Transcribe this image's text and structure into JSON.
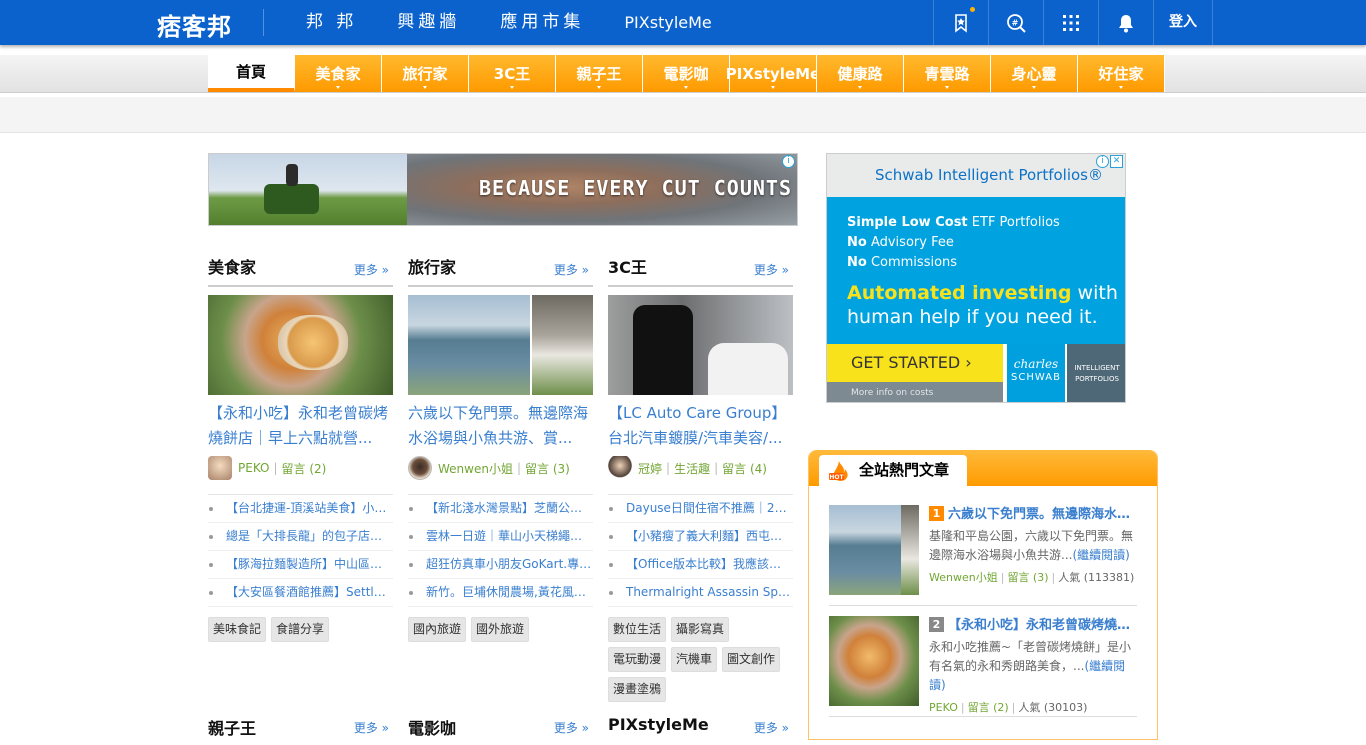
{
  "header": {
    "logo": "痞客邦",
    "nav": [
      "邦 邦",
      "興趣牆",
      "應用市集",
      "PIXstyleMe"
    ],
    "login": "登入"
  },
  "categories": [
    "首頁",
    "美食家",
    "旅行家",
    "3C王",
    "親子王",
    "電影咖",
    "PIXstyleMe",
    "健康路",
    "青雲路",
    "身心靈",
    "好住家"
  ],
  "banner_ad": {
    "text": "BECAUSE EVERY CUT COUNTS"
  },
  "columns": [
    {
      "title": "美食家",
      "more": "更多 »",
      "post_title": "【永和小吃】永和老曾碳烤燒餅店｜早上六點就營...",
      "author": "PEKO",
      "comments": "留言 (2)",
      "channel": "",
      "links": [
        "【台北捷運-頂溪站美食】小…",
        "總是「大排長龍」的包子店！…",
        "【豚海拉麵製造所】中山區拉…",
        "【大安區餐酒館推薦】Settle …"
      ],
      "tags": [
        "美味食記",
        "食譜分享"
      ]
    },
    {
      "title": "旅行家",
      "more": "更多 »",
      "post_title": "六歲以下免門票。無邊際海水浴場與小魚共游、賞...",
      "author": "Wenwen小姐",
      "comments": "留言 (3)",
      "channel": "",
      "links": [
        "【新北淺水灣景點】芝蘭公園…",
        "雲林一日遊｜華山小天梯繩索…",
        "超狂仿真車小朋友GoKart.專…",
        "新竹。巨埔休閒農場,黃花風…"
      ],
      "tags": [
        "國內旅遊",
        "國外旅遊"
      ]
    },
    {
      "title": "3C王",
      "more": "更多 »",
      "post_title": "【LC Auto Care Group】台北汽車鍍膜/汽車美容/...",
      "author": "冠婷",
      "comments": "留言 (4)",
      "channel": "生活趣",
      "links": [
        "Dayuse日間住宿不推薦｜20…",
        "【小豬瘦了義大利麵】西屯聚…",
        "【Office版本比較】我應該買…",
        "Thermalright Assassin Spirit …"
      ],
      "tags": [
        "數位生活",
        "攝影寫真",
        "電玩動漫",
        "汽機車",
        "圖文創作",
        "漫畫塗鴉"
      ]
    }
  ],
  "columns_row2": [
    {
      "title": "親子王",
      "more": "更多 »"
    },
    {
      "title": "電影咖",
      "more": "更多 »"
    },
    {
      "title": "PIXstyleMe",
      "more": "更多 »"
    }
  ],
  "side_ad": {
    "headline": "Schwab Intelligent Portfolios®",
    "lines": [
      {
        "b": "Simple Low Cost",
        "t": " ETF Portfolios"
      },
      {
        "b": "No",
        "t": " Advisory Fee"
      },
      {
        "b": "No",
        "t": " Commissions"
      }
    ],
    "big_highlight": "Automated investing",
    "big_rest": " with human help if you need it.",
    "cta": "GET STARTED  ›",
    "costs": "More info on costs",
    "brand_script": "charles",
    "brand": "SCHWAB",
    "product": "INTELLIGENT PORTFOLIOS"
  },
  "hot": {
    "title": "全站熱門文章",
    "items": [
      {
        "rank": "1",
        "title": "六歲以下免門票。無邊際海水浴場與小魚共游",
        "desc": "基隆和平島公園，六歲以下免門票。無邊際海水浴場與小魚共游...",
        "more": "(繼續閱讀)",
        "author": "Wenwen小姐",
        "comments": "留言 (3)",
        "popularity": "人氣 (113381)"
      },
      {
        "rank": "2",
        "title": "【永和小吃】永和老曾碳烤燒餅店",
        "desc": "永和小吃推薦~「老曾碳烤燒餅」是小有名氣的永和秀朗路美食，...",
        "more": "(繼續閱讀)",
        "author": "PEKO",
        "comments": "留言 (2)",
        "popularity": "人氣 (30103)"
      }
    ]
  }
}
